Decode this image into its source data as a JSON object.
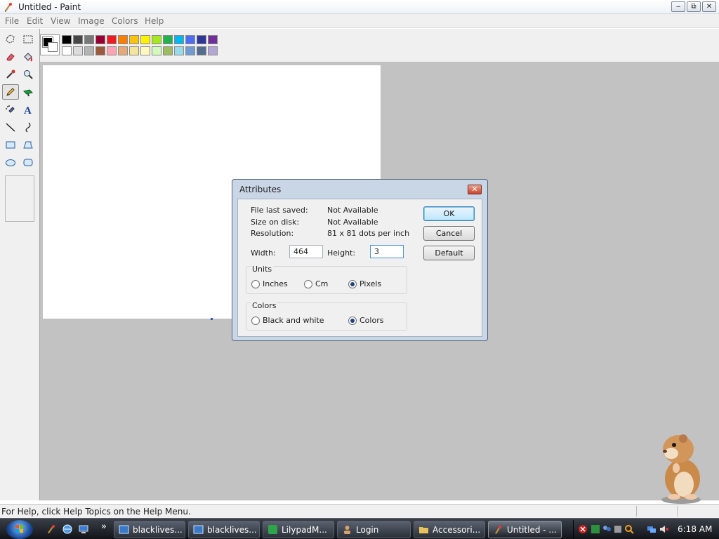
{
  "window": {
    "title": "Untitled - Paint",
    "minimize": "‒",
    "maximize": "⧉",
    "close": "✕"
  },
  "menu": [
    "File",
    "Edit",
    "View",
    "Image",
    "Colors",
    "Help"
  ],
  "tools": [
    "free-form-select",
    "select",
    "eraser",
    "fill-with-color",
    "pick-color",
    "magnifier",
    "pencil",
    "brush",
    "airbrush",
    "text",
    "line",
    "curve",
    "rectangle",
    "polygon",
    "ellipse",
    "rounded-rectangle"
  ],
  "active_tool": "pencil",
  "palette": {
    "foreground": "#000000",
    "background": "#ffffff",
    "row1": [
      "#000000",
      "#464646",
      "#787878",
      "#990030",
      "#ed1c24",
      "#ff7e00",
      "#ffc20e",
      "#fff200",
      "#a8e61d",
      "#22b14c",
      "#00b7ef",
      "#4d6df3",
      "#2f3699",
      "#6f3198"
    ],
    "row2": [
      "#ffffff",
      "#dcdcdc",
      "#b4b4b4",
      "#9c5a3c",
      "#ffa3b1",
      "#e5aa7a",
      "#f5e49c",
      "#fff9bd",
      "#d3f9bc",
      "#9dbb61",
      "#99d9ea",
      "#709ad1",
      "#546d8e",
      "#b5a5d5"
    ]
  },
  "statusbar": {
    "help_text": "For Help, click Help Topics on the Help Menu."
  },
  "dialog": {
    "title": "Attributes",
    "close": "✕",
    "info": [
      {
        "label": "File last saved:",
        "value": "Not Available"
      },
      {
        "label": "Size on disk:",
        "value": "Not Available"
      },
      {
        "label": "Resolution:",
        "value": "81 x 81 dots per inch"
      }
    ],
    "width_label": "Width:",
    "width_value": "464",
    "height_label": "Height:",
    "height_value": "3",
    "units_group": "Units",
    "units": [
      {
        "label": "Inches",
        "selected": false
      },
      {
        "label": "Cm",
        "selected": false
      },
      {
        "label": "Pixels",
        "selected": true
      }
    ],
    "colors_group": "Colors",
    "colors": [
      {
        "label": "Black and white",
        "selected": false
      },
      {
        "label": "Colors",
        "selected": true
      }
    ],
    "buttons": {
      "ok": "OK",
      "cancel": "Cancel",
      "default": "Default"
    }
  },
  "taskbar": {
    "more": "»",
    "tasks": [
      {
        "label": "blacklives..."
      },
      {
        "label": "blacklives..."
      },
      {
        "label": "LilypadM..."
      },
      {
        "label": "Login"
      },
      {
        "label": "Accessori..."
      },
      {
        "label": "Untitled - ..."
      }
    ],
    "active_task": 5,
    "clock": "6:18 AM"
  }
}
